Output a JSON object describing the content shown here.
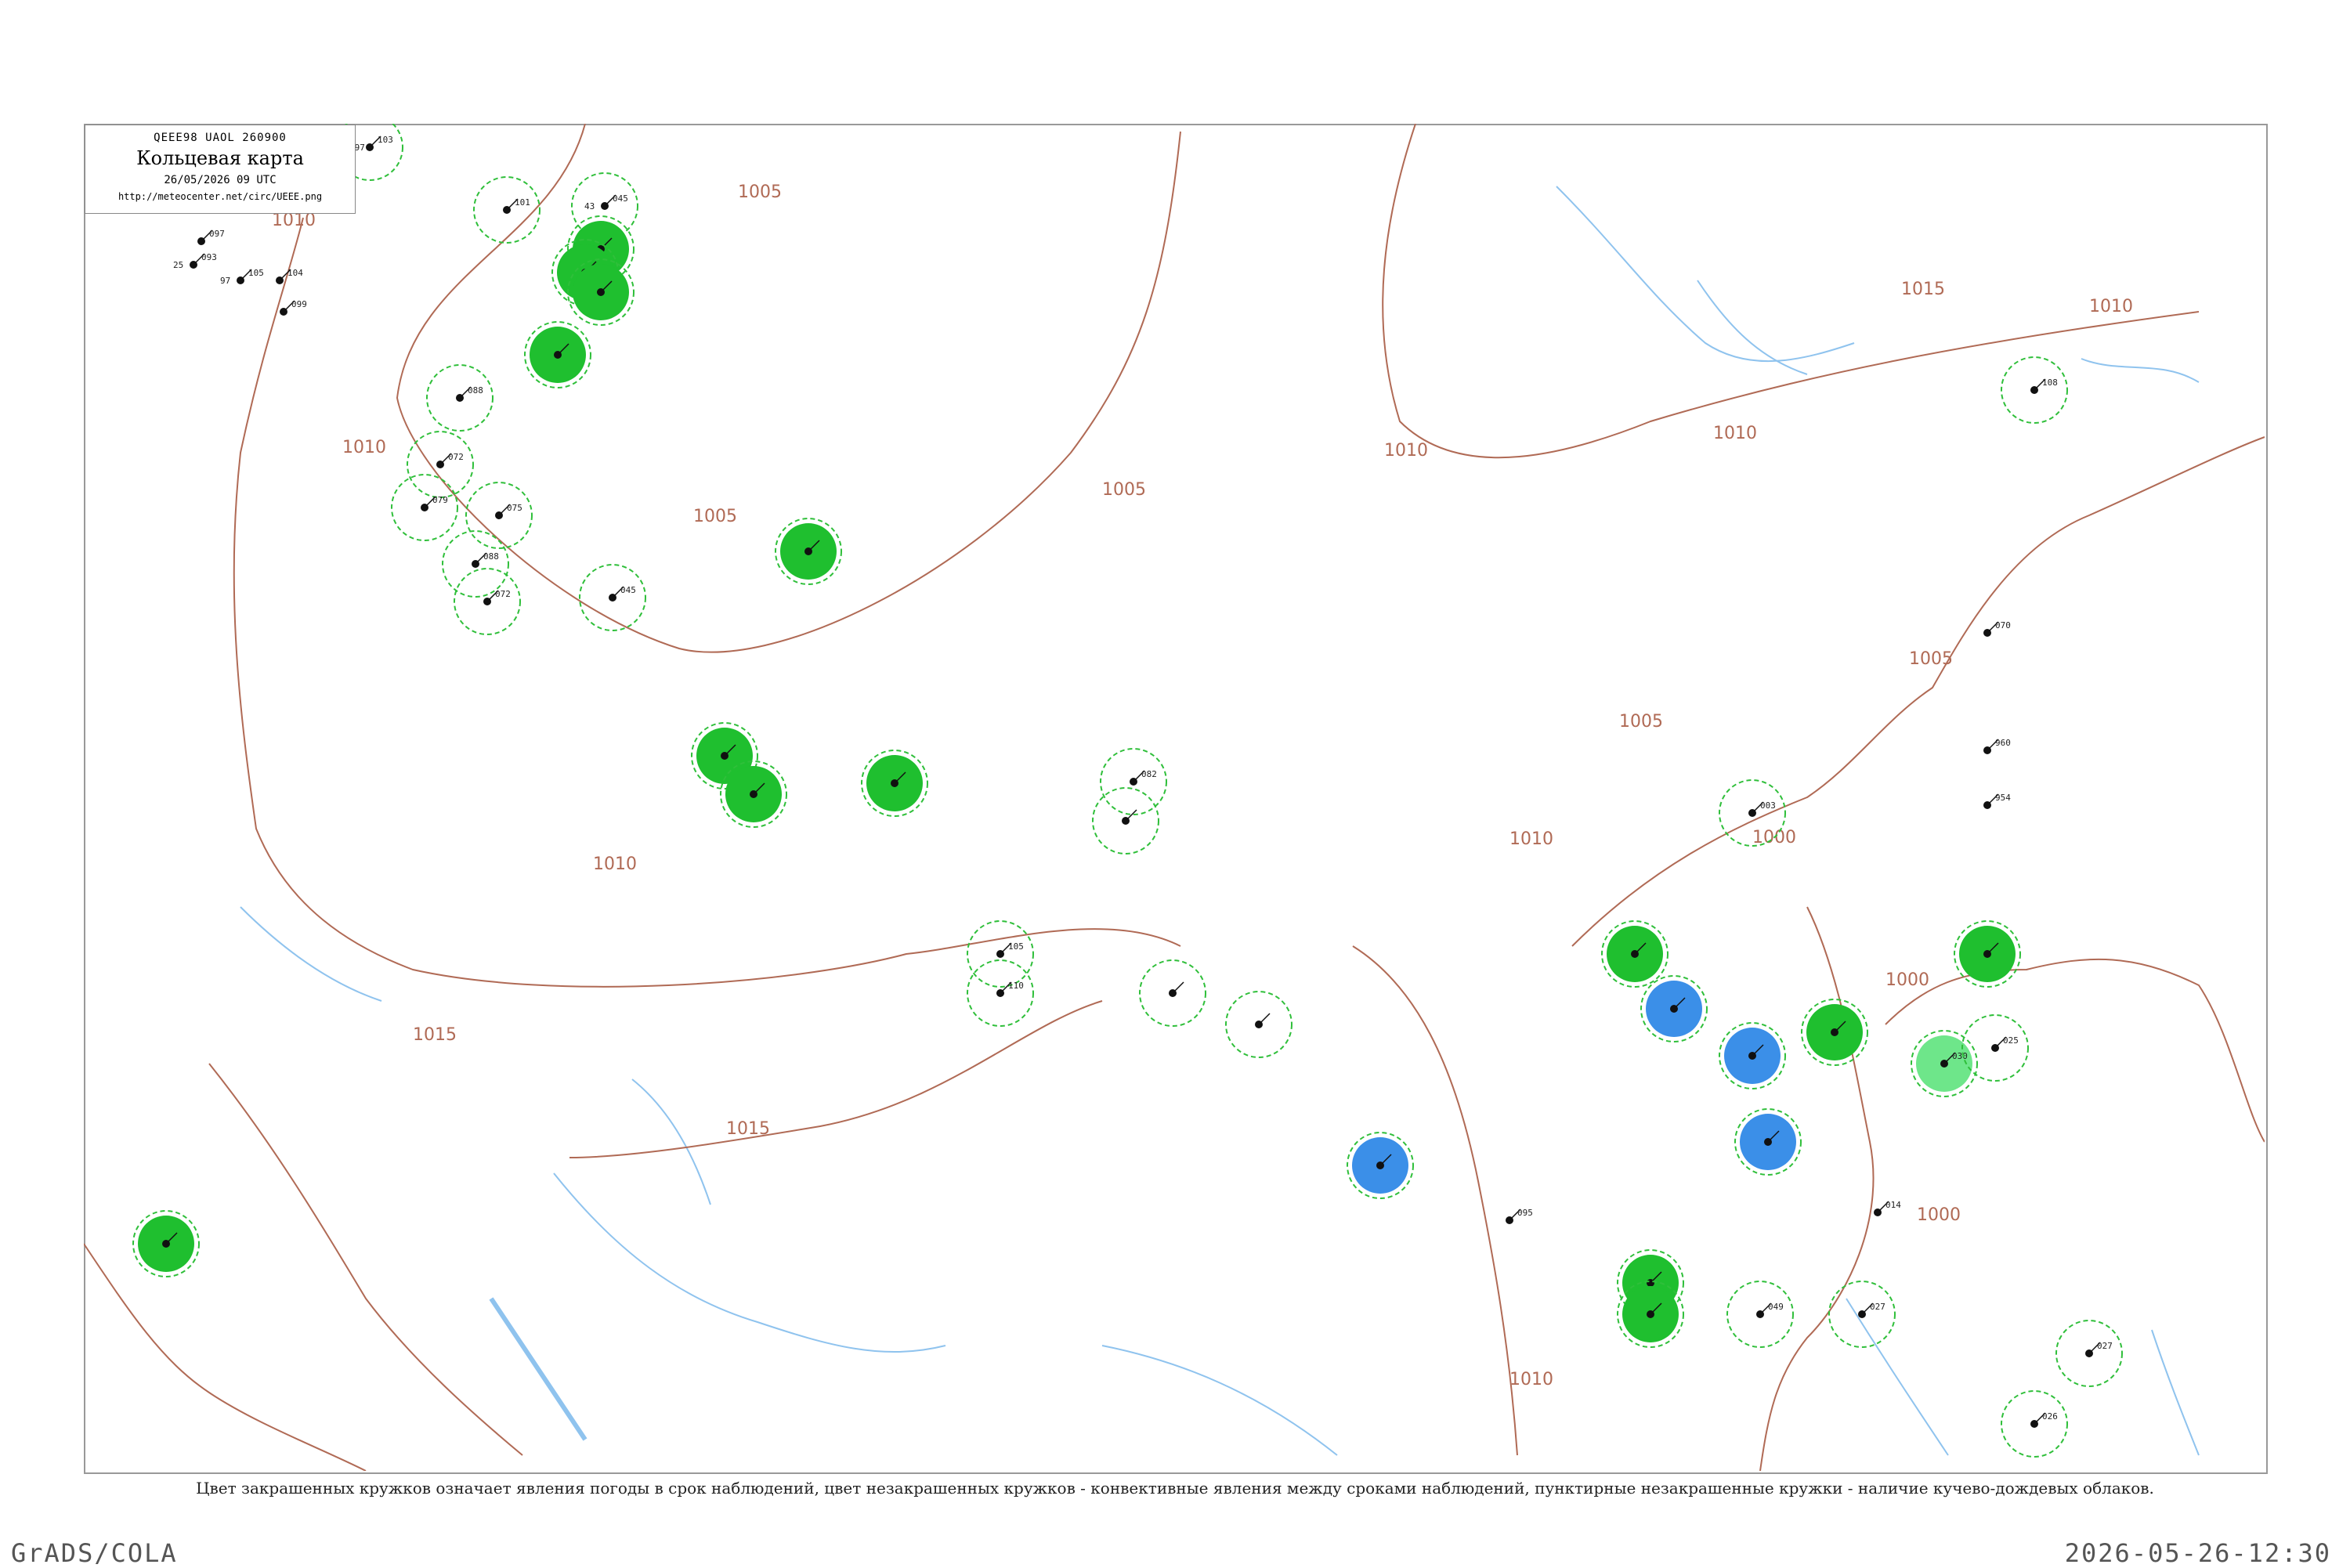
{
  "header": {
    "code": "QEEE98  UAOL  260900",
    "title": "Кольцевая карта",
    "date": "26/05/2026 09 UTC",
    "url": "http://meteocenter.net/circ/UEEE.png"
  },
  "caption": "Цвет закрашенных кружков означает явления погоды в срок наблюдений, цвет незакрашенных кружков - конвективные явления между сроками наблюдений, пунктирные незакрашенные кружки - наличие кучево-дождевых облаков.",
  "footer": {
    "left": "GrADS/COLA",
    "right": "2026-05-26-12:30"
  },
  "colors": {
    "isobar": "#b06a55",
    "river": "#8fc3ee",
    "green_fill": "#1fbf2f",
    "blue_fill": "#3b8fe8",
    "light_green_fill": "#6ee68a",
    "dashed_ring": "#2fbf3a"
  },
  "isobar_labels": [
    {
      "label": "1005"
    },
    {
      "label": "1010"
    },
    {
      "label": "1005"
    },
    {
      "label": "1005"
    },
    {
      "label": "1010"
    },
    {
      "label": "1010"
    },
    {
      "label": "1015"
    },
    {
      "label": "1015"
    },
    {
      "label": "1010"
    },
    {
      "label": "1015"
    },
    {
      "label": "1010"
    },
    {
      "label": "1005"
    },
    {
      "label": "1005"
    },
    {
      "label": "1000"
    },
    {
      "label": "1000"
    },
    {
      "label": "1000"
    },
    {
      "label": "1010"
    },
    {
      "label": "1010"
    },
    {
      "label": "1010"
    }
  ],
  "stations": [
    {
      "t": "103",
      "p": "097",
      "name": "",
      "mark": "dashed"
    },
    {
      "t": "101",
      "p": "",
      "name": "",
      "mark": "dashed"
    },
    {
      "t": "045",
      "p": "43",
      "name": "",
      "mark": "dashed"
    },
    {
      "t": "097",
      "p": "",
      "name": "",
      "mark": "none"
    },
    {
      "t": "093",
      "p": "25",
      "name": "",
      "mark": "none"
    },
    {
      "t": "105",
      "p": "97",
      "name": "",
      "mark": "none"
    },
    {
      "t": "",
      "p": "",
      "name": "",
      "mark": "green"
    },
    {
      "t": "",
      "p": "",
      "name": "",
      "mark": "green"
    },
    {
      "t": "",
      "p": "",
      "name": "",
      "mark": "green"
    },
    {
      "t": "",
      "p": "",
      "name": "",
      "mark": "green"
    },
    {
      "t": "104",
      "p": "",
      "name": "",
      "mark": "none"
    },
    {
      "t": "099",
      "p": "",
      "name": "",
      "mark": "none"
    },
    {
      "t": "088",
      "p": "",
      "name": "",
      "mark": "dashed"
    },
    {
      "t": "072",
      "p": "",
      "name": "",
      "mark": "dashed"
    },
    {
      "t": "075",
      "p": "",
      "name": "",
      "mark": "dashed"
    },
    {
      "t": "079",
      "p": "",
      "name": "",
      "mark": "dashed"
    },
    {
      "t": "088",
      "p": "",
      "name": "",
      "mark": "dashed"
    },
    {
      "t": "072",
      "p": "",
      "name": "",
      "mark": "dashed"
    },
    {
      "t": "045",
      "p": "",
      "name": "",
      "mark": "dashed"
    },
    {
      "t": "",
      "p": "",
      "name": "",
      "mark": "green"
    },
    {
      "t": "",
      "p": "",
      "name": "",
      "mark": "green"
    },
    {
      "t": "",
      "p": "",
      "name": "",
      "mark": "green"
    },
    {
      "t": "",
      "p": "",
      "name": "",
      "mark": "green"
    },
    {
      "t": "082",
      "p": "",
      "name": "",
      "mark": "dashed"
    },
    {
      "t": "",
      "p": "",
      "name": "",
      "mark": "dashed"
    },
    {
      "t": "105",
      "p": "",
      "name": "",
      "mark": "dashed"
    },
    {
      "t": "110",
      "p": "",
      "name": "",
      "mark": "dashed"
    },
    {
      "t": "",
      "p": "",
      "name": "",
      "mark": "dashed"
    },
    {
      "t": "",
      "p": "",
      "name": "",
      "mark": "dashed"
    },
    {
      "t": "",
      "p": "",
      "name": "",
      "mark": "blue"
    },
    {
      "t": "",
      "p": "",
      "name": "",
      "mark": "green"
    },
    {
      "t": "",
      "p": "",
      "name": "",
      "mark": "blue"
    },
    {
      "t": "",
      "p": "",
      "name": "",
      "mark": "blue"
    },
    {
      "t": "",
      "p": "",
      "name": "",
      "mark": "blue"
    },
    {
      "t": "",
      "p": "",
      "name": "",
      "mark": "green"
    },
    {
      "t": "",
      "p": "",
      "name": "",
      "mark": "green"
    },
    {
      "t": "030",
      "p": "",
      "name": "",
      "mark": "lightgreen"
    },
    {
      "t": "025",
      "p": "",
      "name": "",
      "mark": "dashed"
    },
    {
      "t": "003",
      "p": "",
      "name": "",
      "mark": "dashed"
    },
    {
      "t": "108",
      "p": "",
      "name": "",
      "mark": "dashed"
    },
    {
      "t": "",
      "p": "",
      "name": "",
      "mark": "green"
    },
    {
      "t": "",
      "p": "",
      "name": "",
      "mark": "green"
    },
    {
      "t": "",
      "p": "",
      "name": "",
      "mark": "green"
    },
    {
      "t": "049",
      "p": "",
      "name": "",
      "mark": "dashed"
    },
    {
      "t": "027",
      "p": "",
      "name": "",
      "mark": "dashed"
    },
    {
      "t": "027",
      "p": "",
      "name": "",
      "mark": "dashed"
    },
    {
      "t": "026",
      "p": "",
      "name": "",
      "mark": "dashed"
    },
    {
      "t": "095",
      "p": "",
      "name": "",
      "mark": "none"
    },
    {
      "t": "070",
      "p": "",
      "name": "",
      "mark": "none"
    },
    {
      "t": "960",
      "p": "",
      "name": "",
      "mark": "none"
    },
    {
      "t": "954",
      "p": "",
      "name": "",
      "mark": "none"
    },
    {
      "t": "014",
      "p": "",
      "name": "",
      "mark": "none"
    }
  ]
}
